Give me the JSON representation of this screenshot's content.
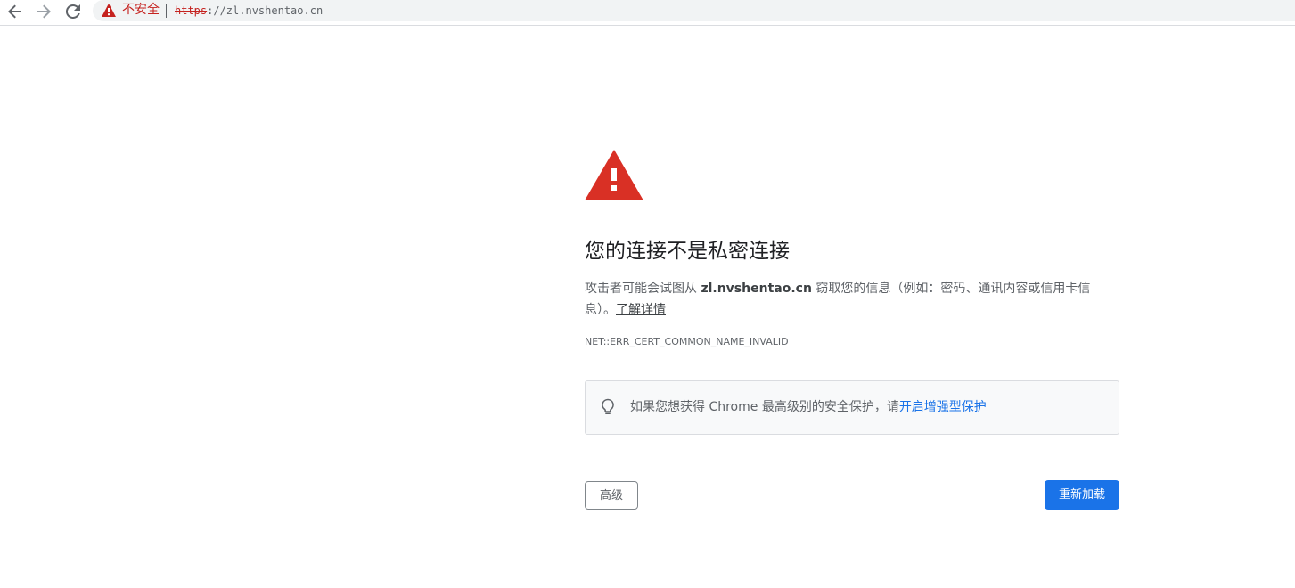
{
  "browser": {
    "security_label": "不安全",
    "url_scheme": "https",
    "url_rest": "://zl.nvshentao.cn",
    "icons": {
      "back": "arrow-left-icon",
      "forward": "arrow-right-icon",
      "reload": "reload-icon",
      "security": "warning-triangle-icon"
    }
  },
  "interstitial": {
    "heading": "您的连接不是私密连接",
    "explanation_prefix": "攻击者可能会试图从 ",
    "domain": "zl.nvshentao.cn",
    "explanation_suffix": " 窃取您的信息（例如：密码、通讯内容或信用卡信息）。",
    "learn_more": "了解详情",
    "error_code": "NET::ERR_CERT_COMMON_NAME_INVALID",
    "enhanced_text": "如果您想获得 Chrome 最高级别的安全保护，请",
    "enhanced_link": "开启增强型保护",
    "advanced_button": "高级",
    "reload_button": "重新加载",
    "colors": {
      "warning_red": "#d93025",
      "primary_blue": "#1a73e8",
      "not_secure_red": "#c5221f"
    },
    "icons": {
      "warning": "warning-triangle-icon",
      "bulb": "lightbulb-icon"
    }
  }
}
